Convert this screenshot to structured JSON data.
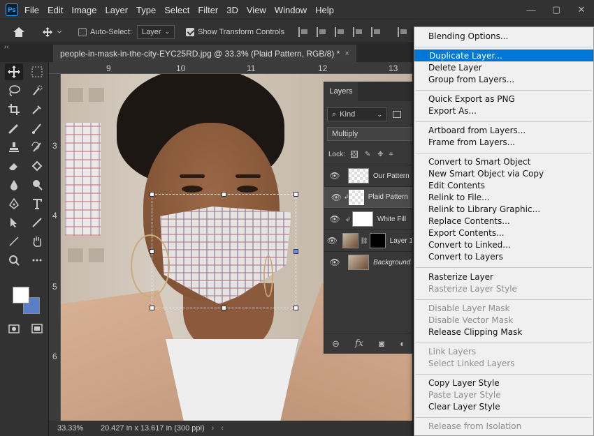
{
  "app": {
    "logo": "Ps"
  },
  "menubar": {
    "items": [
      "File",
      "Edit",
      "Image",
      "Layer",
      "Type",
      "Select",
      "Filter",
      "3D",
      "View",
      "Window",
      "Help"
    ]
  },
  "window_controls": {
    "minimize": "—",
    "maximize": "▢",
    "close": "✕"
  },
  "options": {
    "auto_select_label": "Auto-Select:",
    "auto_select_checked": false,
    "target_value": "Layer",
    "show_transform_label": "Show Transform Controls",
    "show_transform_checked": true
  },
  "document": {
    "tab_title": "people-in-mask-in-the-city-EYC25RD.jpg @ 33.3% (Plaid Pattern, RGB/8) *",
    "close_glyph": "×",
    "collapse_glyph": "‹‹"
  },
  "rulers": {
    "top": [
      "9",
      "10",
      "11",
      "12",
      "13"
    ],
    "left": [
      "3",
      "4",
      "5",
      "6"
    ]
  },
  "status": {
    "zoom": "33.33%",
    "doc_size": "20.427 in x 13.617 in (300 ppi)",
    "arrow_left": "‹",
    "arrow_right": "›"
  },
  "tools": {
    "icons": [
      "move-icon",
      "marquee-icon",
      "lasso-icon",
      "quick-select-icon",
      "crop-icon",
      "eyedropper-icon",
      "healing-brush-icon",
      "brush-icon",
      "clone-stamp-icon",
      "history-brush-icon",
      "eraser-icon",
      "paint-bucket-icon",
      "blur-icon",
      "dodge-icon",
      "pen-icon",
      "type-icon",
      "path-select-icon",
      "rectangle-icon",
      "hand-icon",
      "zoom-icon",
      "more-tools-icon"
    ],
    "foreground_color": "#ffffff",
    "background_color": "#5b7fc7"
  },
  "layers_panel": {
    "tab": "Layers",
    "filter_kind": "Kind",
    "blend_mode": "Multiply",
    "lock_label": "Lock:",
    "layers": [
      {
        "name": "Our Pattern",
        "thumb": "transparent",
        "selected": false,
        "clipped": false
      },
      {
        "name": "Plaid Pattern",
        "thumb": "transparent",
        "selected": true,
        "clipped": true
      },
      {
        "name": "White Fill",
        "thumb": "white",
        "selected": false,
        "clipped": true
      },
      {
        "name": "Layer 1",
        "thumb": "photo",
        "selected": false,
        "clipped": false,
        "has_mask": true
      },
      {
        "name": "Background",
        "thumb": "photo",
        "selected": false,
        "clipped": false
      }
    ],
    "footer_icons": [
      "link-icon",
      "fx-icon",
      "mask-icon",
      "adjustment-icon"
    ]
  },
  "context_menu": {
    "items": [
      {
        "label": "Blending Options...",
        "state": "normal"
      },
      {
        "label": "Duplicate Layer...",
        "state": "highlighted"
      },
      {
        "label": "Delete Layer",
        "state": "normal"
      },
      {
        "label": "Group from Layers...",
        "state": "normal"
      },
      {
        "label": "Quick Export as PNG",
        "state": "normal"
      },
      {
        "label": "Export As...",
        "state": "normal"
      },
      {
        "label": "Artboard from Layers...",
        "state": "normal"
      },
      {
        "label": "Frame from Layers...",
        "state": "normal"
      },
      {
        "label": "Convert to Smart Object",
        "state": "normal"
      },
      {
        "label": "New Smart Object via Copy",
        "state": "normal"
      },
      {
        "label": "Edit Contents",
        "state": "normal"
      },
      {
        "label": "Relink to File...",
        "state": "normal"
      },
      {
        "label": "Relink to Library Graphic...",
        "state": "normal"
      },
      {
        "label": "Replace Contents...",
        "state": "normal"
      },
      {
        "label": "Export Contents...",
        "state": "normal"
      },
      {
        "label": "Convert to Linked...",
        "state": "normal"
      },
      {
        "label": "Convert to Layers",
        "state": "normal"
      },
      {
        "label": "Rasterize Layer",
        "state": "normal"
      },
      {
        "label": "Rasterize Layer Style",
        "state": "disabled"
      },
      {
        "label": "Disable Layer Mask",
        "state": "disabled"
      },
      {
        "label": "Disable Vector Mask",
        "state": "disabled"
      },
      {
        "label": "Release Clipping Mask",
        "state": "normal"
      },
      {
        "label": "Link Layers",
        "state": "disabled"
      },
      {
        "label": "Select Linked Layers",
        "state": "disabled"
      },
      {
        "label": "Copy Layer Style",
        "state": "normal"
      },
      {
        "label": "Paste Layer Style",
        "state": "disabled"
      },
      {
        "label": "Clear Layer Style",
        "state": "normal"
      },
      {
        "label": "Release from Isolation",
        "state": "disabled"
      }
    ]
  }
}
